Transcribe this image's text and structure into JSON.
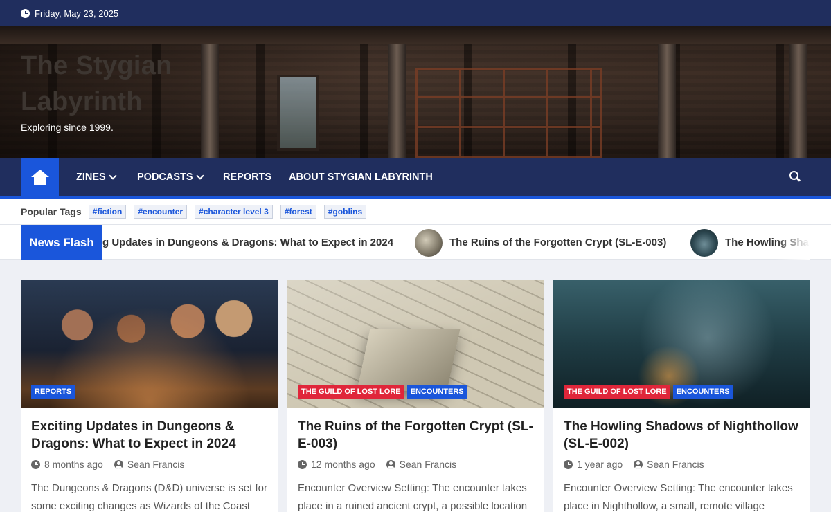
{
  "topbar": {
    "date": "Friday, May 23, 2025"
  },
  "site": {
    "title": "The Stygian Labyrinth",
    "tagline": "Exploring since 1999."
  },
  "nav": {
    "items": [
      {
        "label": "ZINES",
        "dropdown": true
      },
      {
        "label": "PODCASTS",
        "dropdown": true
      },
      {
        "label": "REPORTS",
        "dropdown": false
      },
      {
        "label": "ABOUT STYGIAN LABYRINTH",
        "dropdown": false
      }
    ]
  },
  "tags": {
    "label": "Popular Tags",
    "items": [
      "#fiction",
      "#encounter",
      "#character level 3",
      "#forest",
      "#goblins"
    ]
  },
  "news_flash": {
    "label": "News Flash",
    "items": [
      "g Updates in Dungeons & Dragons: What to Expect in 2024",
      "The Ruins of the Forgotten Crypt (SL-E-003)",
      "The Howling Sha"
    ]
  },
  "cards": [
    {
      "categories": [
        "REPORTS"
      ],
      "title": "Exciting Updates in Dungeons & Dragons: What to Expect in 2024",
      "time": "8 months ago",
      "author": "Sean Francis",
      "excerpt": "The Dungeons & Dragons (D&D) universe is set for some exciting changes as Wizards of the Coast"
    },
    {
      "categories": [
        "THE GUILD OF LOST LORE",
        "ENCOUNTERS"
      ],
      "title": "The Ruins of the Forgotten Crypt (SL-E-003)",
      "time": "12 months ago",
      "author": "Sean Francis",
      "excerpt": "Encounter Overview Setting: The encounter takes place in a ruined ancient crypt, a possible location"
    },
    {
      "categories": [
        "THE GUILD OF LOST LORE",
        "ENCOUNTERS"
      ],
      "title": "The Howling Shadows of Nighthollow (SL-E-002)",
      "time": "1 year ago",
      "author": "Sean Francis",
      "excerpt": "Encounter Overview Setting: The encounter takes place in Nighthollow, a small, remote village"
    }
  ],
  "colors": {
    "navy": "#202e5e",
    "accent_blue": "#1a56db",
    "category_red": "#e0263a"
  }
}
